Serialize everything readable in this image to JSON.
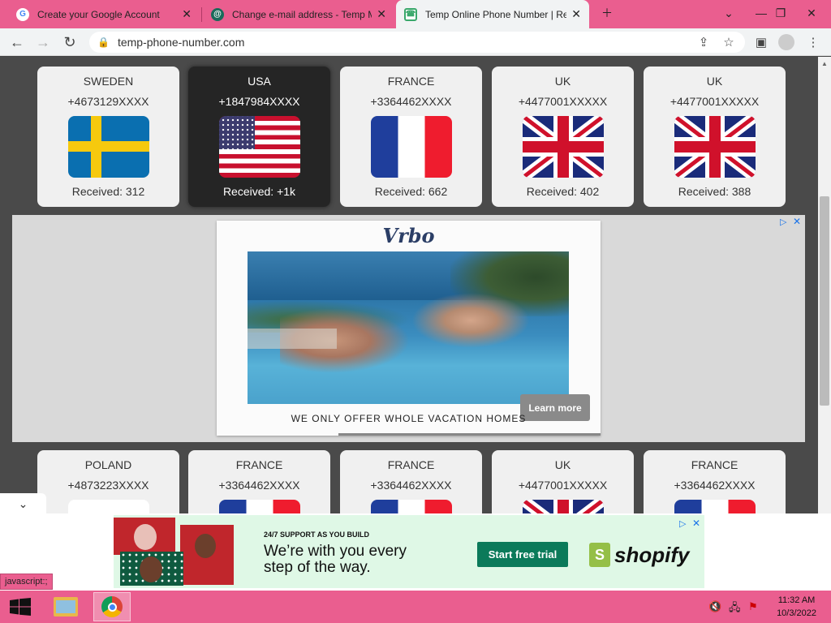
{
  "tabs": [
    {
      "title": "Create your Google Account",
      "icon": "google-icon"
    },
    {
      "title": "Change e-mail address - Temp M",
      "icon": "temp-mail-icon"
    },
    {
      "title": "Temp Online Phone Number | Re",
      "icon": "phone-number-icon"
    }
  ],
  "toolbar": {
    "url": "temp-phone-number.com"
  },
  "cards_row1": [
    {
      "country": "SWEDEN",
      "number": "+4673129XXXX",
      "received": "Received: 312",
      "flag": "sweden"
    },
    {
      "country": "USA",
      "number": "+1847984XXXX",
      "received": "Received: +1k",
      "flag": "usa"
    },
    {
      "country": "FRANCE",
      "number": "+3364462XXXX",
      "received": "Received: 662",
      "flag": "france"
    },
    {
      "country": "UK",
      "number": "+4477001XXXXX",
      "received": "Received: 402",
      "flag": "uk"
    },
    {
      "country": "UK",
      "number": "+4477001XXXXX",
      "received": "Received: 388",
      "flag": "uk"
    }
  ],
  "cards_row2": [
    {
      "country": "POLAND",
      "number": "+4873223XXXX",
      "flag": "poland"
    },
    {
      "country": "FRANCE",
      "number": "+3364462XXXX",
      "flag": "france"
    },
    {
      "country": "FRANCE",
      "number": "+3364462XXXX",
      "flag": "france"
    },
    {
      "country": "UK",
      "number": "+4477001XXXXX",
      "flag": "uk"
    },
    {
      "country": "FRANCE",
      "number": "+3364462XXXX",
      "flag": "france"
    }
  ],
  "ad1": {
    "brand": "Vrbo",
    "caption": "WE ONLY OFFER WHOLE VACATION HOMES",
    "learn_more": "Learn more"
  },
  "ad2": {
    "support": "24/7 SUPPORT AS YOU BUILD",
    "headline_line1": "We’re with you every",
    "headline_line2": "step of the way.",
    "cta": "Start free trial",
    "brand": "shopify"
  },
  "status_bar": "javascript:;",
  "clock": {
    "time": "11:32 AM",
    "date": "10/3/2022"
  },
  "colors": {
    "tabstrip": "#ea5e8f",
    "page_bg": "#4a4a4a",
    "card": "#f0f0f0",
    "card_active": "#252525"
  }
}
